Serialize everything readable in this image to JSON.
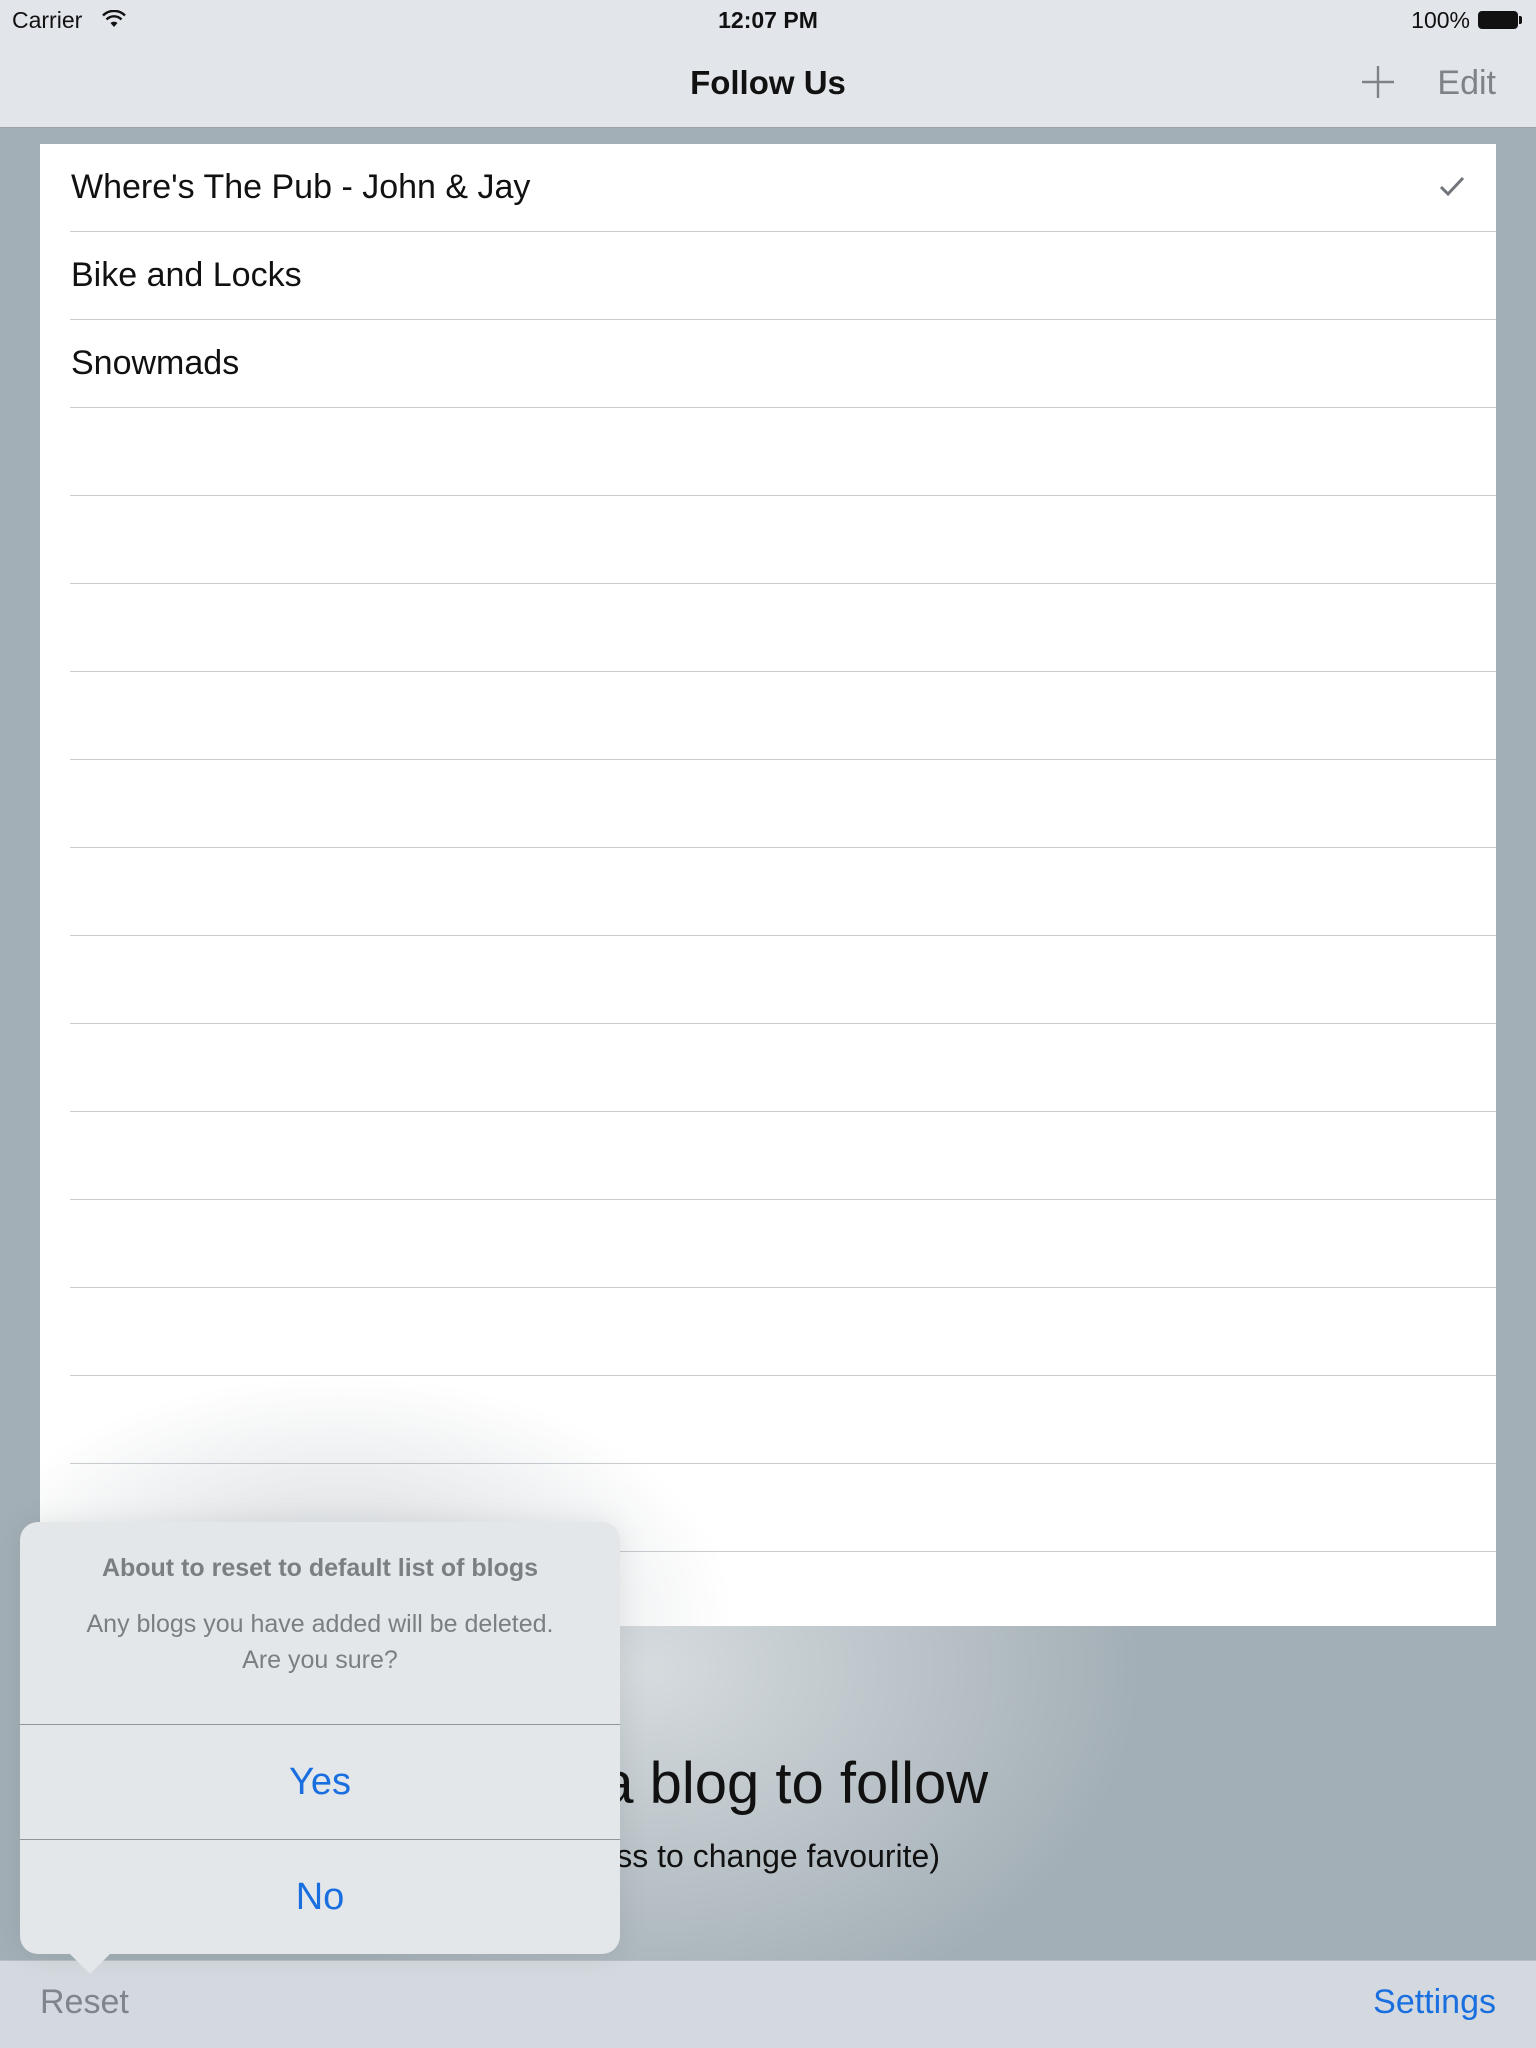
{
  "status_bar": {
    "carrier": "Carrier",
    "time": "12:07 PM",
    "battery": "100%"
  },
  "nav": {
    "title": "Follow Us",
    "edit_label": "Edit",
    "add_icon": "plus-icon"
  },
  "list": {
    "items": [
      {
        "label": "Where's The Pub - John & Jay",
        "checked": true
      },
      {
        "label": "Bike and Locks",
        "checked": false
      },
      {
        "label": "Snowmads",
        "checked": false
      }
    ]
  },
  "background": {
    "select_text": "ct a blog to follow",
    "hint_text": "press to change favourite)"
  },
  "toolbar": {
    "reset_label": "Reset",
    "settings_label": "Settings"
  },
  "alert": {
    "title": "About to reset to default list of blogs",
    "message_line1": "Any blogs you have added will be deleted.",
    "message_line2": "Are you sure?",
    "yes_label": "Yes",
    "no_label": "No"
  },
  "colors": {
    "accent": "#1a6fe0"
  }
}
